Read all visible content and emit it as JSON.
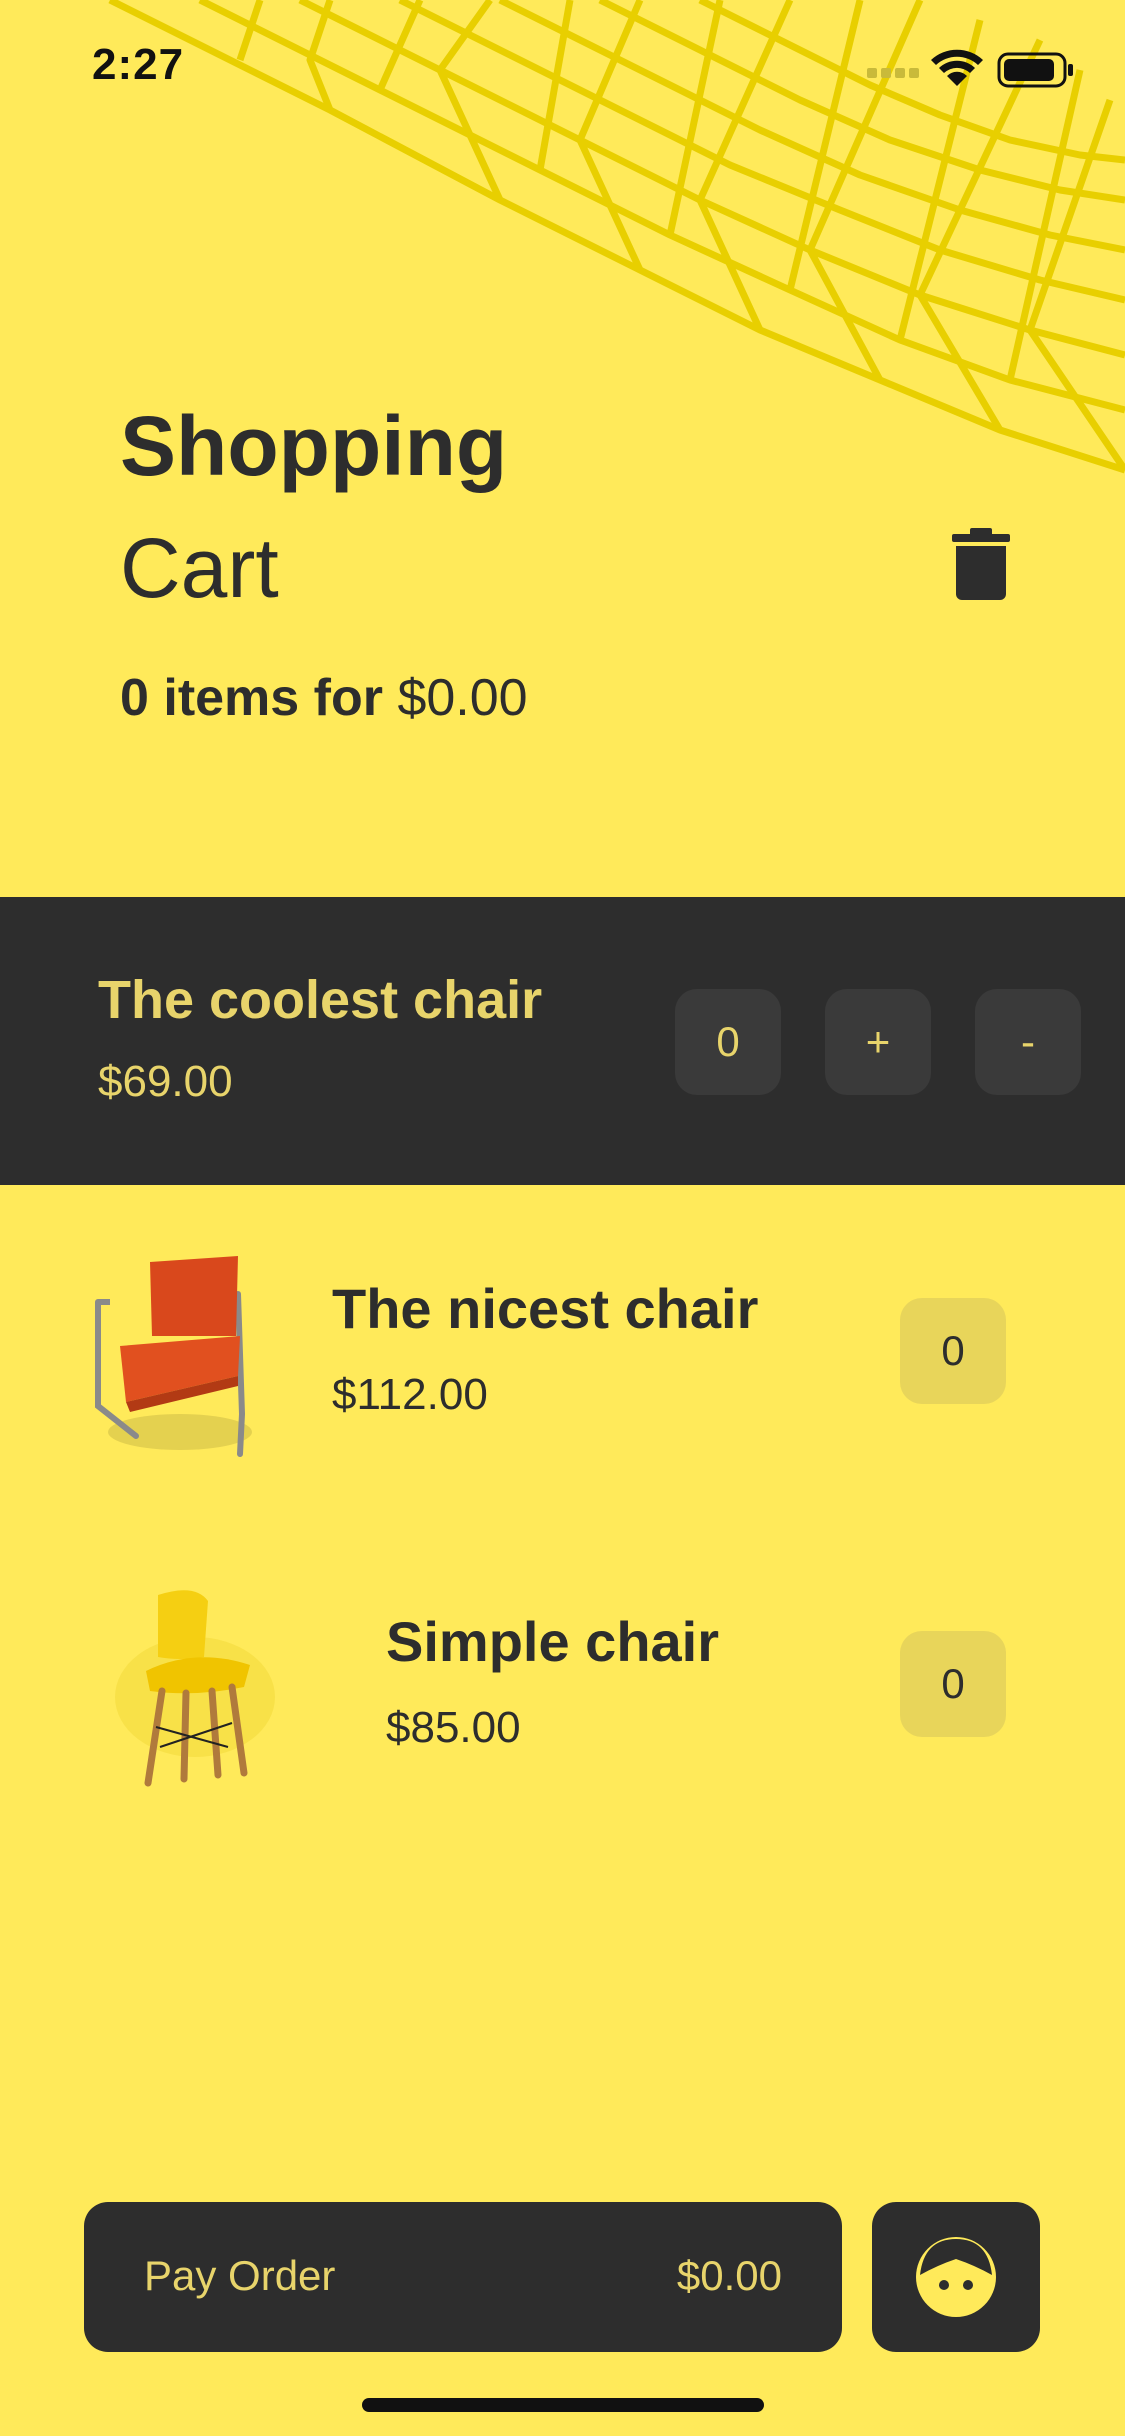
{
  "status_bar": {
    "time": "2:27"
  },
  "header": {
    "title_line1": "Shopping",
    "title_line2": "Cart",
    "summary_count": "0 items for",
    "summary_total": "$0.00"
  },
  "selected_item": {
    "name": "The coolest chair",
    "price": "$69.00",
    "quantity": "0",
    "plus_label": "+",
    "minus_label": "-"
  },
  "items": [
    {
      "name": "The nicest chair",
      "price": "$112.00",
      "quantity": "0",
      "image": "orange-chair-image"
    },
    {
      "name": "Simple chair",
      "price": "$85.00",
      "quantity": "0",
      "image": "yellow-chair-image"
    }
  ],
  "footer": {
    "pay_label": "Pay Order",
    "pay_total": "$0.00"
  },
  "icons": [
    "wifi-icon",
    "battery-icon",
    "signal-icon",
    "trash-icon",
    "avatar-icon"
  ],
  "colors": {
    "background": "#FFEA5A",
    "dark": "#2D2D2D",
    "accent_text": "#E8D46B",
    "qty_bg": "#E8D55A"
  }
}
